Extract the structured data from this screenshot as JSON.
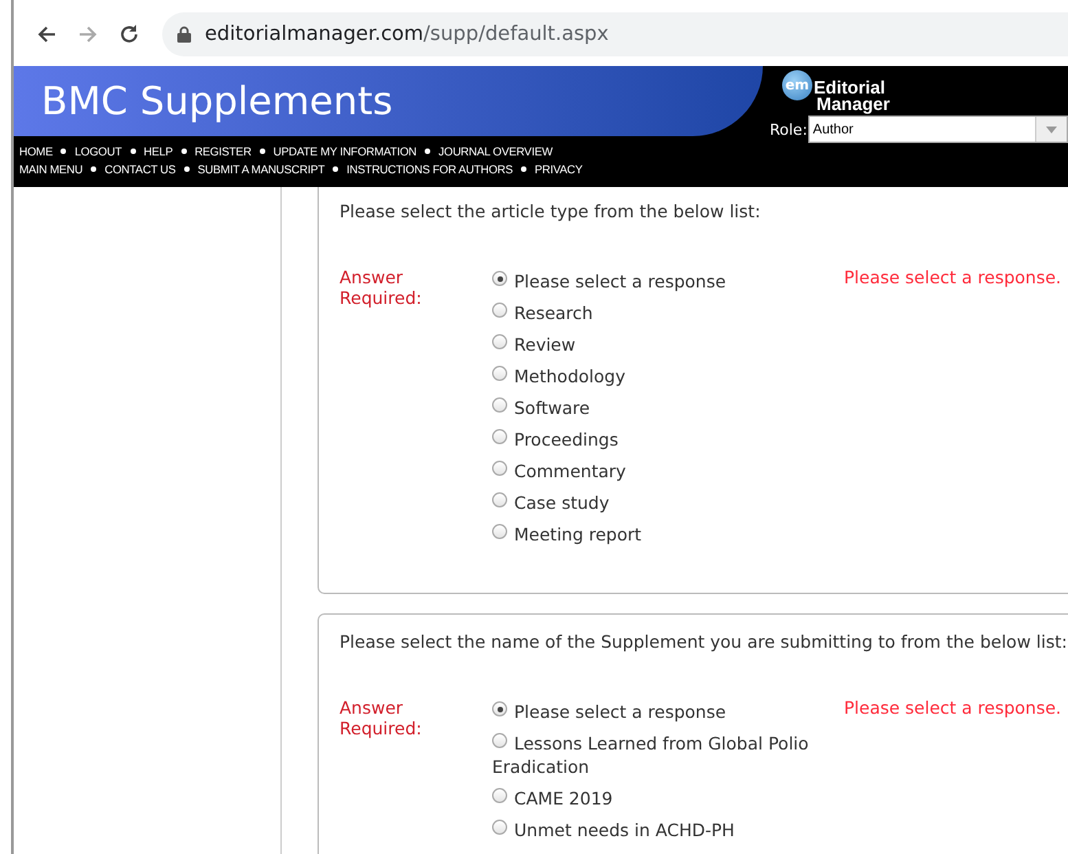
{
  "browser": {
    "url_host": "editorialmanager.com",
    "url_path": "/supp/default.aspx"
  },
  "header": {
    "title": "BMC Supplements",
    "logo_line1": "Editorial",
    "logo_line2": "Manager",
    "logo_badge": "em",
    "role_label": "Role:",
    "role_value": "Author",
    "nav_rows": [
      [
        "HOME",
        "LOGOUT",
        "HELP",
        "REGISTER",
        "UPDATE MY INFORMATION",
        "JOURNAL OVERVIEW"
      ],
      [
        "MAIN MENU",
        "CONTACT US",
        "SUBMIT A MANUSCRIPT",
        "INSTRUCTIONS FOR AUTHORS",
        "PRIVACY"
      ]
    ]
  },
  "questions": [
    {
      "prompt": "Please select the article type from the below list:",
      "required_label": "Answer Required:",
      "error": "Please select a response.",
      "top_cut": true,
      "options": [
        {
          "label": "Please select a response",
          "selected": true
        },
        {
          "label": "Research",
          "selected": false
        },
        {
          "label": "Review",
          "selected": false
        },
        {
          "label": "Methodology",
          "selected": false
        },
        {
          "label": "Software",
          "selected": false
        },
        {
          "label": "Proceedings",
          "selected": false
        },
        {
          "label": "Commentary",
          "selected": false
        },
        {
          "label": "Case study",
          "selected": false
        },
        {
          "label": "Meeting report",
          "selected": false
        }
      ]
    },
    {
      "prompt": "Please select the name of the Supplement you are submitting to from the below list:",
      "required_label": "Answer Required:",
      "error": "Please select a response.",
      "top_cut": false,
      "options": [
        {
          "label": "Please select a response",
          "selected": true
        },
        {
          "label": "Lessons Learned from Global Polio Eradication",
          "selected": false
        },
        {
          "label": "CAME 2019",
          "selected": false
        },
        {
          "label": "Unmet needs in ACHD-PH",
          "selected": false
        }
      ]
    }
  ]
}
